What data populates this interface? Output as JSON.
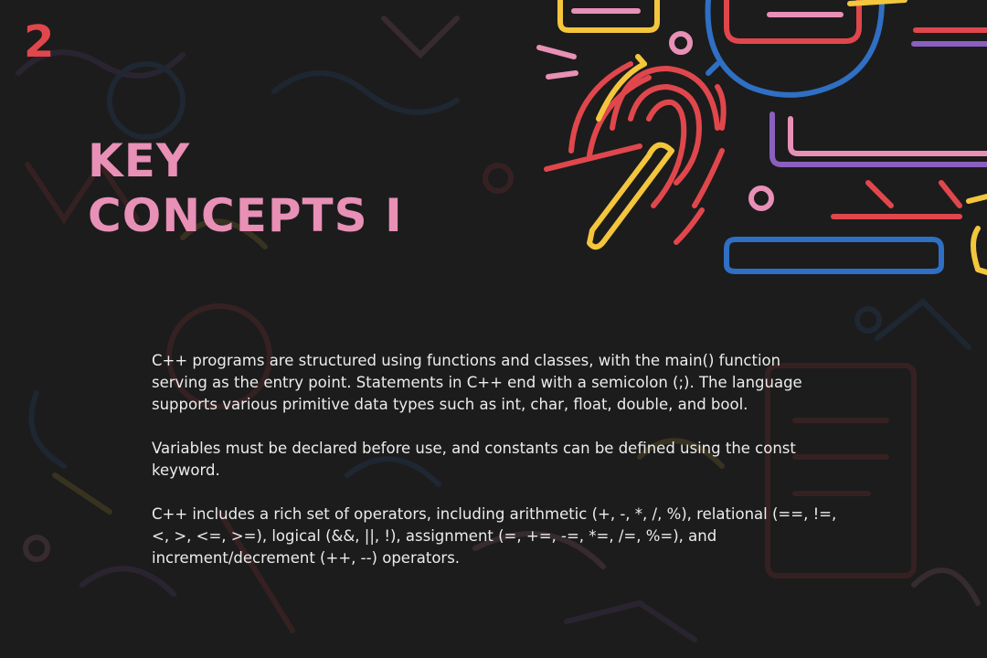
{
  "slide": {
    "number": "2",
    "title_line1": "KEY",
    "title_line2": "CONCEPTS I",
    "paragraphs": [
      "C++ programs are structured using functions and classes, with the main() function serving as the entry point. Statements in C++ end with a semicolon (;). The language supports various primitive data types such as int, char, float, double, and bool.",
      "Variables must be declared before use, and constants can be defined using the const keyword.",
      "C++ includes a rich set of operators, including arithmetic (+, -, *, /, %), relational (==, !=, <, >, <=, >=), logical (&&, ||, !), assignment (=, +=, -=, *=, /=, %=), and increment/decrement (++, --) operators."
    ]
  },
  "colors": {
    "background": "#1c1c1c",
    "title": "#e890b6",
    "number": "#e0474c",
    "text": "#ececec",
    "doodle_red": "#e0474c",
    "doodle_yellow": "#f4c63d",
    "doodle_blue": "#2f6fc4",
    "doodle_pink": "#e890b6",
    "doodle_purple": "#8b5fbf"
  },
  "illustration": {
    "icons": [
      "fingerprint-icon",
      "magnifier-icon",
      "monitor-icon",
      "keyboard-icon",
      "document-icon"
    ]
  }
}
